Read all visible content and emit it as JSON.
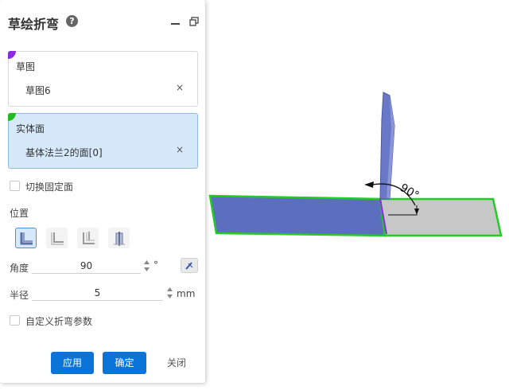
{
  "panel": {
    "title": "草绘折弯",
    "help_icon": "help-icon",
    "minimize_icon": "minimize-icon",
    "restore_icon": "restore-icon"
  },
  "sketch": {
    "label": "草图",
    "value": "草图6",
    "remove": "×",
    "corner_color": "#8a2be2"
  },
  "face": {
    "label": "实体面",
    "value": "基体法兰2的面[0]",
    "remove": "×",
    "corner_color": "#22bb22"
  },
  "switch_fixed_face": {
    "label": "切换固定面",
    "checked": false
  },
  "position": {
    "label": "位置",
    "options": [
      {
        "icon": "bend-inside-icon",
        "active": true
      },
      {
        "icon": "bend-outside-icon",
        "active": false
      },
      {
        "icon": "bend-centerline-icon",
        "active": false
      },
      {
        "icon": "bend-middle-icon",
        "active": false
      }
    ]
  },
  "angle": {
    "label": "角度",
    "value": "90",
    "unit": "°"
  },
  "radius": {
    "label": "半径",
    "value": "5",
    "unit": "mm"
  },
  "custom_params": {
    "label": "自定义折弯参数",
    "checked": false
  },
  "buttons": {
    "apply": "应用",
    "ok": "确定",
    "close": "关闭"
  },
  "viewport": {
    "angle_annotation": "90°"
  },
  "colors": {
    "accent": "#0a74d8",
    "flange": "#5c6fbf",
    "plate": "#c7c7c7",
    "highlight": "#22cc22"
  }
}
